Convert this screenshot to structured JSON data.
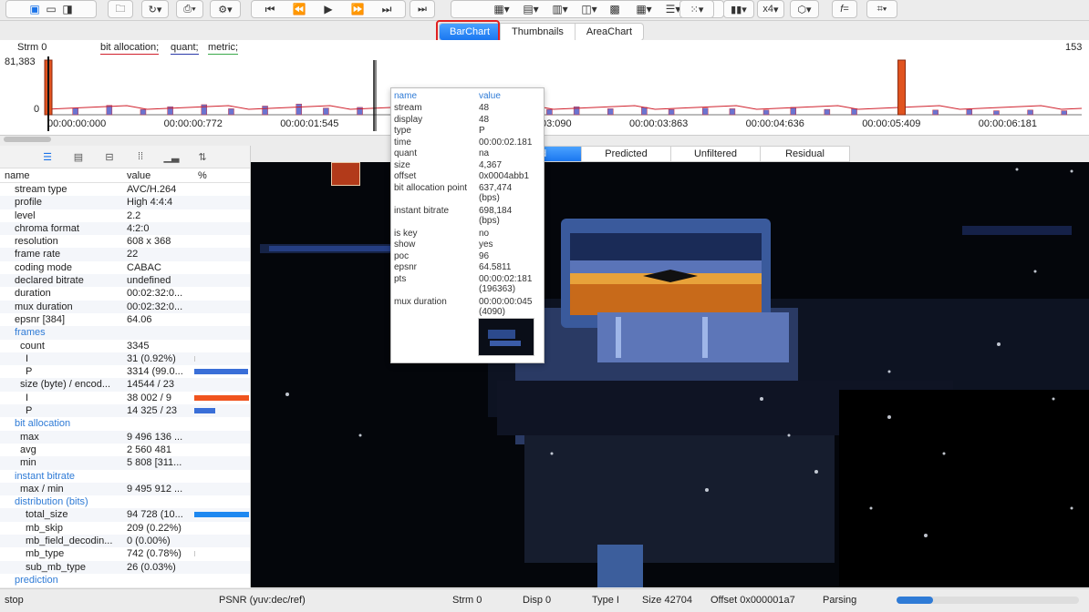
{
  "toolbar": {
    "zoom": "x4"
  },
  "view_tabs": [
    "BarChart",
    "Thumbnails",
    "AreaChart"
  ],
  "chart": {
    "stream_label": "Strm 0",
    "legend": [
      {
        "label": "bit allocation;",
        "color": "#d0202c"
      },
      {
        "label": "quant;",
        "color": "#2a3aa8"
      },
      {
        "label": "metric;",
        "color": "#3aa84a"
      }
    ],
    "y_max_label": "81,383",
    "y_min_label": "0",
    "right_label": "153",
    "time_ticks": [
      "00:00:00:000",
      "00:00:00:772",
      "00:00:01:545",
      "00:00:02:318",
      "00:00:03:090",
      "00:00:03:863",
      "00:00:04:636",
      "00:00:05:409",
      "00:00:06:181"
    ]
  },
  "chart_data": {
    "type": "bar",
    "series": [
      {
        "name": "bit allocation",
        "color": "#d0202c"
      },
      {
        "name": "quant",
        "color": "#2a3aa8"
      },
      {
        "name": "metric",
        "color": "#3aa84a"
      }
    ],
    "ylim": [
      0,
      81383
    ],
    "x_ticks": [
      "00:00:00:000",
      "00:00:00:772",
      "00:00:01:545",
      "00:00:02:318",
      "00:00:03:090",
      "00:00:03:863",
      "00:00:04:636",
      "00:00:05:409",
      "00:00:06:181"
    ],
    "x_range": [
      0,
      153
    ],
    "key_frames": [
      {
        "index": 0,
        "value": 81383
      },
      {
        "index": 126,
        "value": 81383
      }
    ],
    "p_frames": [
      [
        4,
        10000
      ],
      [
        9,
        14000
      ],
      [
        14,
        8000
      ],
      [
        18,
        12000
      ],
      [
        23,
        15000
      ],
      [
        27,
        9000
      ],
      [
        32,
        13000
      ],
      [
        37,
        16000
      ],
      [
        41,
        10000
      ],
      [
        46,
        11000
      ],
      [
        51,
        14000
      ],
      [
        55,
        9000
      ],
      [
        60,
        12000
      ],
      [
        65,
        15000
      ],
      [
        69,
        10000
      ],
      [
        74,
        8000
      ],
      [
        78,
        12000
      ],
      [
        83,
        9000
      ],
      [
        88,
        11000
      ],
      [
        92,
        8000
      ],
      [
        97,
        10000
      ],
      [
        101,
        9000
      ],
      [
        106,
        7000
      ],
      [
        110,
        11000
      ],
      [
        115,
        8000
      ],
      [
        119,
        9000
      ],
      [
        131,
        7000
      ],
      [
        136,
        8000
      ],
      [
        140,
        6000
      ],
      [
        145,
        7000
      ],
      [
        150,
        6000
      ]
    ]
  },
  "tooltip": {
    "header_name": "name",
    "header_value": "value",
    "rows": [
      {
        "n": "stream",
        "v": "48"
      },
      {
        "n": "display",
        "v": "48"
      },
      {
        "n": "type",
        "v": "P"
      },
      {
        "n": "time",
        "v": "00:00:02.181"
      },
      {
        "n": "quant",
        "v": "na"
      },
      {
        "n": "size",
        "v": "4,367"
      },
      {
        "n": "offset",
        "v": "0x0004abb1"
      },
      {
        "n": "bit allocation point",
        "v": "637,474\n(bps)"
      },
      {
        "n": "instant bitrate",
        "v": "698,184\n(bps)"
      },
      {
        "n": "is key",
        "v": "no"
      },
      {
        "n": "show",
        "v": "yes"
      },
      {
        "n": "poc",
        "v": "96"
      },
      {
        "n": "epsnr",
        "v": "64.5811"
      },
      {
        "n": "pts",
        "v": "00:00:02:181\n(196363)"
      },
      {
        "n": "mux duration",
        "v": "00:00:00:045\n(4090)"
      }
    ]
  },
  "video_tabs": [
    "ed",
    "Predicted",
    "Unfiltered",
    "Residual"
  ],
  "info_panel": {
    "col_name": "name",
    "col_value": "value",
    "col_pct": "%",
    "rows": [
      {
        "n": "stream type",
        "v": "AVC/H.264",
        "indent": 1
      },
      {
        "n": "profile",
        "v": "High 4:4:4",
        "indent": 1
      },
      {
        "n": "level",
        "v": "2.2",
        "indent": 1
      },
      {
        "n": "chroma format",
        "v": "4:2:0",
        "indent": 1
      },
      {
        "n": "resolution",
        "v": "608 x 368",
        "indent": 1
      },
      {
        "n": "frame rate",
        "v": "22",
        "indent": 1
      },
      {
        "n": "coding mode",
        "v": "CABAC",
        "indent": 1
      },
      {
        "n": "declared bitrate",
        "v": "undefined",
        "indent": 1
      },
      {
        "n": "duration",
        "v": "00:02:32:0...",
        "indent": 1
      },
      {
        "n": "mux duration",
        "v": "00:02:32:0...",
        "indent": 1
      },
      {
        "n": "epsnr [384]",
        "v": "64.06",
        "indent": 1
      },
      {
        "n": "frames",
        "v": "",
        "indent": 1,
        "section": true
      },
      {
        "n": "count",
        "v": "3345",
        "indent": 2
      },
      {
        "n": "I",
        "v": "31 (0.92%)",
        "indent": 3,
        "bar": 0.01,
        "bar_color": "#c8c8c8"
      },
      {
        "n": "P",
        "v": "3314 (99.0...",
        "indent": 3,
        "bar": 0.99,
        "bar_color": "#3a6fd8"
      },
      {
        "n": "size (byte) / encod...",
        "v": "14544 / 23",
        "indent": 2
      },
      {
        "n": "I",
        "v": "38 002 / 9",
        "indent": 3,
        "bar": 1.0,
        "bar_color": "#f0541e"
      },
      {
        "n": "P",
        "v": "14 325 / 23",
        "indent": 3,
        "bar": 0.38,
        "bar_color": "#3a6fd8"
      },
      {
        "n": "bit allocation",
        "v": "",
        "indent": 1,
        "section": true
      },
      {
        "n": "max",
        "v": "9 496 136 ...",
        "indent": 2
      },
      {
        "n": "avg",
        "v": "2 560 481",
        "indent": 2
      },
      {
        "n": "min",
        "v": "5 808 [311...",
        "indent": 2
      },
      {
        "n": "instant bitrate",
        "v": "",
        "indent": 1,
        "section": true
      },
      {
        "n": "max / min",
        "v": "9 495 912 ...",
        "indent": 2
      },
      {
        "n": "distribution (bits)",
        "v": "",
        "indent": 1,
        "section": true
      },
      {
        "n": "total_size",
        "v": "94 728 (10...",
        "indent": 3,
        "bar": 1.0,
        "bar_color": "#1e88f0"
      },
      {
        "n": "mb_skip",
        "v": "209 (0.22%)",
        "indent": 3
      },
      {
        "n": "mb_field_decodin...",
        "v": "0 (0.00%)",
        "indent": 3
      },
      {
        "n": "mb_type",
        "v": "742 (0.78%)",
        "indent": 3,
        "bar": 0.01,
        "bar_color": "#c8c8c8"
      },
      {
        "n": "sub_mb_type",
        "v": "26 (0.03%)",
        "indent": 3
      },
      {
        "n": "prediction",
        "v": "",
        "indent": 1,
        "section": true
      }
    ]
  },
  "statusbar": {
    "state": "stop",
    "psnr": "PSNR (yuv:dec/ref)",
    "stream": "Strm 0",
    "disp": "Disp 0",
    "type": "Type I",
    "size": "Size 42704",
    "offset": "Offset 0x000001a7",
    "parsing": "Parsing",
    "progress": 0.2
  }
}
